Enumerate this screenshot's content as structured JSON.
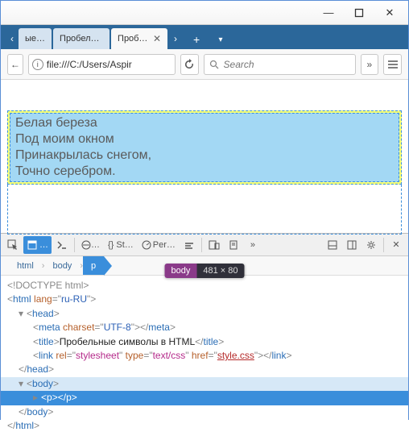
{
  "window": {
    "minimize": "—",
    "close": "✕"
  },
  "tabs": {
    "overflow_left": "ые…",
    "items": [
      {
        "label": "Пробельные…"
      },
      {
        "label": "Пробель…"
      }
    ]
  },
  "urlbar": {
    "url": "file:///C:/Users/Aspir",
    "search_placeholder": "Search"
  },
  "page": {
    "lines": [
      "Белая береза",
      "Под моим окном",
      "Принакрылась снегом,",
      "Точно серебром."
    ]
  },
  "tooltip": {
    "tag": "body",
    "dims": "481 × 80"
  },
  "devtools": {
    "tabs": {
      "styles": "{} St…",
      "perf": "Per…"
    },
    "breadcrumb": [
      "html",
      "body",
      "p"
    ],
    "dom": {
      "doctype": "<!DOCTYPE html>",
      "html_open": {
        "tag": "html",
        "attr": "lang",
        "val": "ru-RU"
      },
      "head": "head",
      "meta": {
        "tag": "meta",
        "attr": "charset",
        "val": "UTF-8"
      },
      "title": {
        "tag": "title",
        "text": "Пробельные символы в HTML"
      },
      "link": {
        "tag": "link",
        "rel": "stylesheet",
        "type": "text/css",
        "href": "style.css"
      },
      "body": "body",
      "p": "p",
      "html_close": "html"
    }
  }
}
